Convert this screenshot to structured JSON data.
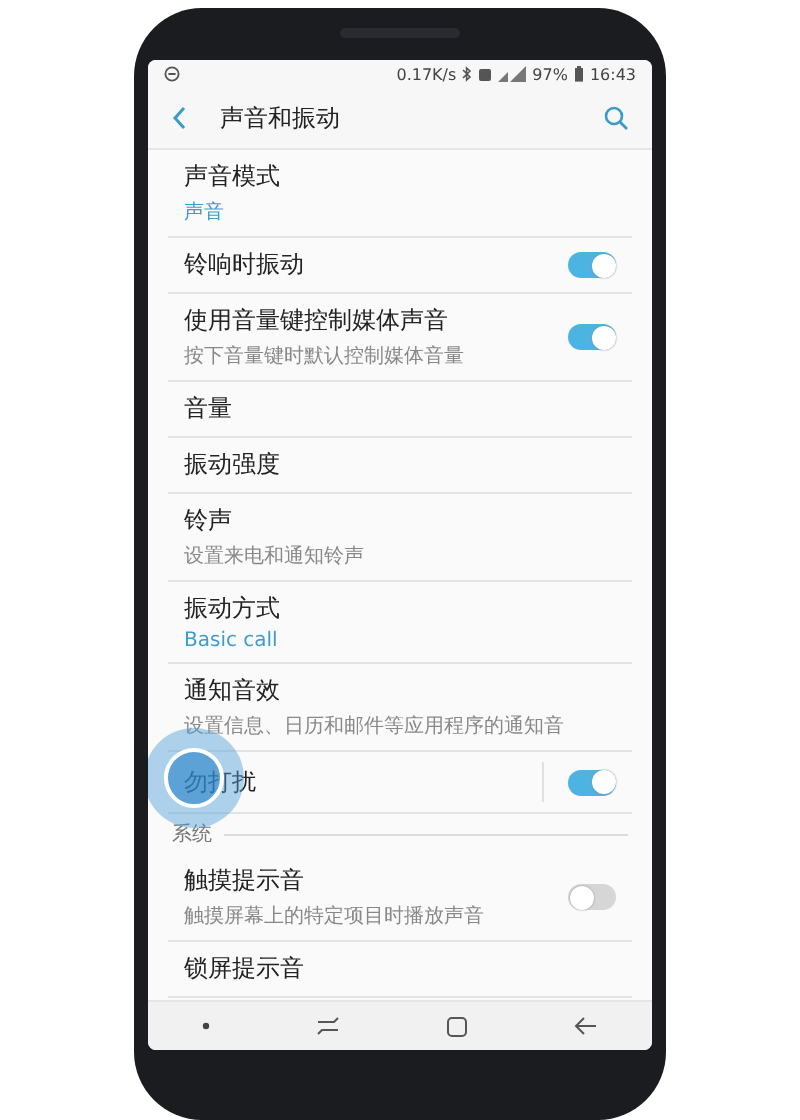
{
  "status_bar": {
    "speed": "0.17K/s",
    "battery": "97%",
    "time": "16:43"
  },
  "app_bar": {
    "title": "声音和振动"
  },
  "items": [
    {
      "kind": "link",
      "title": "声音模式",
      "value": "声音"
    },
    {
      "kind": "toggle",
      "title": "铃响时振动",
      "on": true
    },
    {
      "kind": "toggle",
      "title": "使用音量键控制媒体声音",
      "description": "按下音量键时默认控制媒体音量",
      "on": true
    },
    {
      "kind": "link",
      "title": "音量"
    },
    {
      "kind": "link",
      "title": "振动强度"
    },
    {
      "kind": "link",
      "title": "铃声",
      "description": "设置来电和通知铃声"
    },
    {
      "kind": "link",
      "title": "振动方式",
      "value": "Basic call"
    },
    {
      "kind": "link",
      "title": "通知音效",
      "description": "设置信息、日历和邮件等应用程序的通知音"
    },
    {
      "kind": "toggle",
      "title": "勿打扰",
      "on": true,
      "split": true,
      "touched": true
    },
    {
      "kind": "header",
      "title": "系统"
    },
    {
      "kind": "toggle",
      "title": "触摸提示音",
      "description": "触摸屏幕上的特定项目时播放声音",
      "on": false
    },
    {
      "kind": "link",
      "title": "锁屏提示音"
    }
  ]
}
